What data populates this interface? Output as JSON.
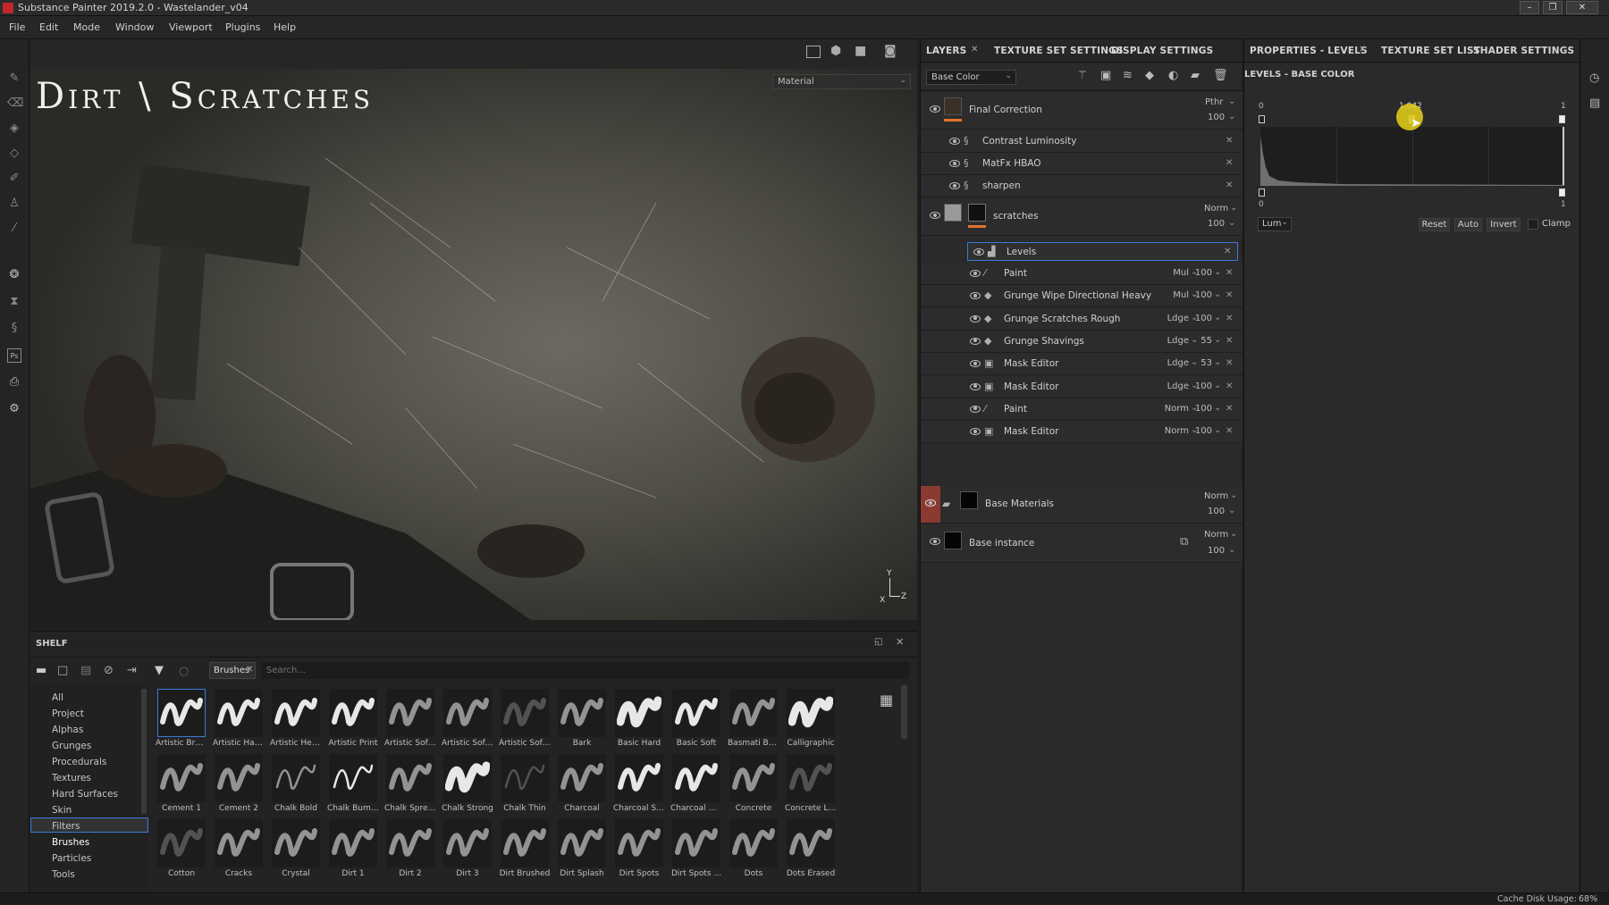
{
  "window": {
    "title": "Substance Painter 2019.2.0 - Wastelander_v04"
  },
  "menu": [
    "File",
    "Edit",
    "Mode",
    "Window",
    "Viewport",
    "Plugins",
    "Help"
  ],
  "viewport": {
    "overlay_title": "Dirt \\ Scratches",
    "material_dropdown": "Material",
    "axis_y": "Y",
    "axis_x": "X",
    "axis_z": "Z"
  },
  "layers_panel": {
    "tabs": [
      "LAYERS",
      "TEXTURE SET SETTINGS",
      "DISPLAY SETTINGS"
    ],
    "channel": "Base Color",
    "layers": [
      {
        "name": "Final Correction",
        "blend": "Pthr",
        "opacity": "100"
      },
      {
        "name": "Contrast Luminosity"
      },
      {
        "name": "MatFx HBAO"
      },
      {
        "name": "sharpen"
      },
      {
        "name": "scratches",
        "blend": "Norm",
        "opacity": "100"
      },
      {
        "name": "Levels"
      },
      {
        "name": "Paint",
        "blend": "Mul",
        "opacity": "100"
      },
      {
        "name": "Grunge Wipe Directional Heavy",
        "blend": "Mul",
        "opacity": "100"
      },
      {
        "name": "Grunge Scratches Rough",
        "blend": "Ldge",
        "opacity": "100"
      },
      {
        "name": "Grunge Shavings",
        "blend": "Ldge",
        "opacity": "55"
      },
      {
        "name": "Mask Editor",
        "blend": "Ldge",
        "opacity": "53"
      },
      {
        "name": "Mask Editor",
        "blend": "Ldge",
        "opacity": "100"
      },
      {
        "name": "Paint",
        "blend": "Norm",
        "opacity": "100"
      },
      {
        "name": "Mask Editor",
        "blend": "Norm",
        "opacity": "100"
      },
      {
        "name": "Base Materials",
        "blend": "Norm",
        "opacity": "100"
      },
      {
        "name": "Base instance",
        "blend": "Norm",
        "opacity": "100"
      }
    ]
  },
  "properties_panel": {
    "tabs": [
      "PROPERTIES - LEVELS",
      "TEXTURE SET LIST",
      "SHADER SETTINGS"
    ],
    "section": "LEVELS - BASE COLOR",
    "input_min": "0",
    "input_max": "1",
    "gamma": "1.042",
    "output_min": "0",
    "output_max": "1",
    "mode": "Lum",
    "buttons": [
      "Reset",
      "Auto",
      "Invert"
    ],
    "clamp_label": "Clamp"
  },
  "shelf": {
    "title": "SHELF",
    "filter_tag": "Brushes",
    "search_placeholder": "Search...",
    "categories": [
      "All",
      "Project",
      "Alphas",
      "Grunges",
      "Procedurals",
      "Textures",
      "Hard Surfaces",
      "Skin",
      "Filters",
      "Brushes",
      "Particles",
      "Tools"
    ],
    "selected_category": "Brushes",
    "brushes": [
      "Artistic Brus...",
      "Artistic Hair...",
      "Artistic Hea...",
      "Artistic Print",
      "Artistic Soft ...",
      "Artistic Soft ...",
      "Artistic Soft ...",
      "Bark",
      "Basic Hard",
      "Basic Soft",
      "Basmati Bru...",
      "Calligraphic",
      "Cement 1",
      "Cement 2",
      "Chalk Bold",
      "Chalk Bumpy",
      "Chalk Spread",
      "Chalk Strong",
      "Chalk Thin",
      "Charcoal",
      "Charcoal Str...",
      "Charcoal Wi...",
      "Concrete",
      "Concrete Li...",
      "Cotton",
      "Cracks",
      "Crystal",
      "Dirt 1",
      "Dirt 2",
      "Dirt 3",
      "Dirt Brushed",
      "Dirt Splash",
      "Dirt Spots",
      "Dirt Spots ...",
      "Dots",
      "Dots Erased"
    ]
  },
  "status": {
    "cache": "Cache Disk Usage:",
    "cache_value": "68%"
  },
  "colors": {
    "accent_orange": "#e0742a",
    "selection_blue": "#3a7bd5",
    "cursor_yellow": "#e8d21a"
  }
}
